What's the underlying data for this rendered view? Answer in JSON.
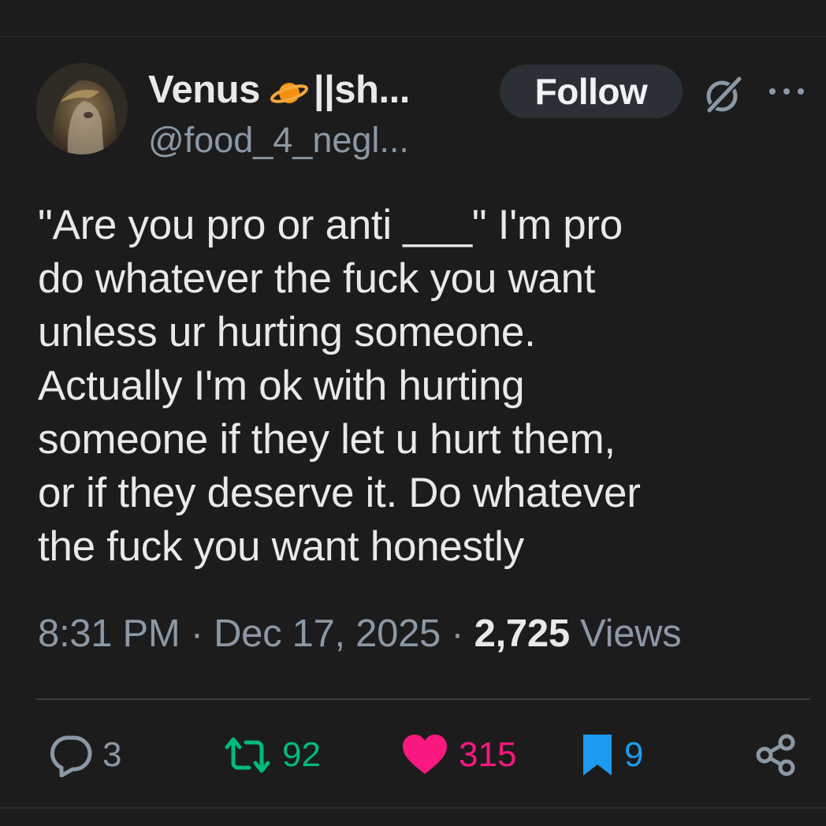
{
  "tweet": {
    "display_name": "Venus",
    "display_name_suffix": "||sh...",
    "handle": "@food_4_negl...",
    "follow_label": "Follow",
    "text": "\"Are you pro or anti ___\" I'm pro\ndo whatever the fuck you want\nunless ur hurting someone.\nActually I'm ok with hurting\nsomeone if they let u hurt them,\nor if they deserve it. Do whatever\nthe fuck you want honestly",
    "time": "8:31 PM",
    "date": "Dec 17, 2025",
    "views_count": "2,725",
    "views_label": "Views",
    "separator": "·"
  },
  "actions": {
    "replies": "3",
    "retweets": "92",
    "likes": "315",
    "bookmarks": "9"
  },
  "icons": {
    "display_name_emoji": "ringed-planet-icon",
    "grok": "grok-icon",
    "more": "more-icon",
    "reply": "reply-icon",
    "retweet": "retweet-icon",
    "like": "heart-icon",
    "bookmark": "bookmark-icon",
    "share": "share-icon"
  },
  "colors": {
    "background": "#1c1c1c",
    "text": "#e7e9ea",
    "secondary": "#8b98a5",
    "retweet": "#00ba7c",
    "like": "#f91880",
    "bookmark": "#1d9bf0",
    "planet": "#f4900c"
  }
}
